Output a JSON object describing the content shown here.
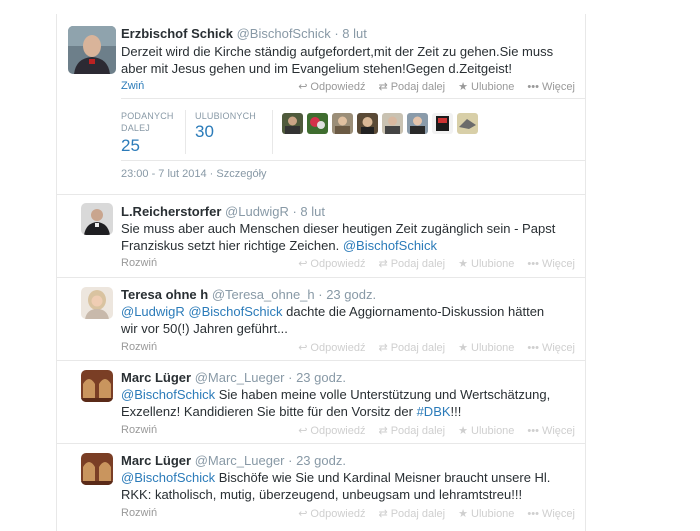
{
  "main_tweet": {
    "name": "Erzbischof Schick",
    "handle": "@BischofSchick",
    "time": "· 8 lut",
    "text": "Derzeit wird die Kirche ständig aufgefordert,mit der Zeit zu gehen.Sie muss aber mit Jesus gehen und im Evangelium stehen!Gegen d.Zeitgeist!",
    "collapse_label": "Zwiń",
    "actions": {
      "reply": "Odpowiedź",
      "retweet": "Podaj dalej",
      "favorite": "Ulubione",
      "more": "Więcej"
    },
    "stats": {
      "retweets_label_1": "PODANYCH",
      "retweets_label_2": "DALEJ",
      "retweets_value": "25",
      "favorites_label": "ULUBIONYCH",
      "favorites_value": "30"
    },
    "datetime": "23:00 - 7 lut 2014 · Szczegóły"
  },
  "replies": [
    {
      "name": "L.Reicherstorfer",
      "handle": "@LudwigR",
      "time": "· 8 lut",
      "text_plain": "Sie muss aber auch Menschen dieser heutigen Zeit zugänglich sein - Papst Franziskus setzt hier richtige Zeichen.",
      "mention": "@BischofSchick",
      "expand_label": "Rozwiń"
    },
    {
      "name": "Teresa ohne h",
      "handle": "@Teresa_ohne_h",
      "time": "· 23 godz.",
      "mention_1": "@LudwigR",
      "mention_2": "@BischofSchick",
      "text_plain": "dachte die Aggiornamento-Diskussion hätten wir vor 50(!) Jahren geführt...",
      "expand_label": "Rozwiń"
    },
    {
      "name": "Marc Lüger",
      "handle": "@Marc_Lueger",
      "time": "· 23 godz.",
      "mention": "@BischofSchick",
      "text_plain": "Sie haben meine volle Unterstützung und Wertschätzung, Exzellenz! Kandidieren Sie bitte für den Vorsitz der",
      "hashtag": "#DBK",
      "text_tail": "!!!",
      "expand_label": "Rozwiń"
    },
    {
      "name": "Marc Lüger",
      "handle": "@Marc_Lueger",
      "time": "· 23 godz.",
      "mention": "@BischofSchick",
      "text_plain": "Bischöfe wie Sie und Kardinal Meisner braucht unsere Hl. RKK: katholisch, mutig, überzeugend, unbeugsam und lehramtstreu!!!",
      "expand_label": "Rozwiń"
    }
  ],
  "reply_actions": {
    "reply": "Odpowiedź",
    "retweet": "Podaj dalej",
    "favorite": "Ulubione",
    "more": "Więcej"
  },
  "colors": {
    "link": "#2b7bb9",
    "muted": "#8899a6",
    "border": "#e8e8e8"
  },
  "icons": [
    "reply-icon",
    "retweet-icon",
    "favorite-icon",
    "more-icon"
  ]
}
